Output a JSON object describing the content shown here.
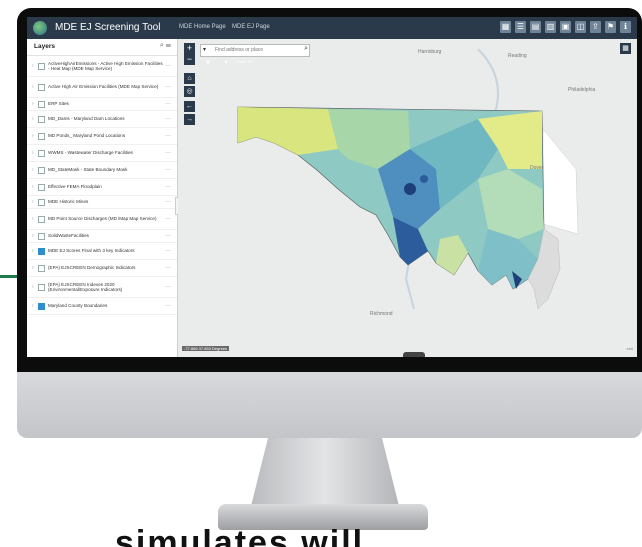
{
  "app": {
    "title": "MDE EJ Screening Tool",
    "links": [
      "MDE Home Page",
      "MDE EJ Page"
    ]
  },
  "toolbar": {
    "icons": [
      "layers-icon",
      "legend-icon",
      "basemap-icon",
      "table-icon",
      "print-icon",
      "measure-icon",
      "share-icon",
      "bookmark-icon",
      "info-icon"
    ]
  },
  "layers_panel": {
    "title": "Layers",
    "items": [
      {
        "label": "ActiveHighAirEmissions - Active High Emission Facilities - Heat Map (MDE Map Service)",
        "checked": false
      },
      {
        "label": "Active High Air Emission Facilities (MDE Map Service)",
        "checked": false
      },
      {
        "label": "ERP Sites",
        "checked": false
      },
      {
        "label": "MD_Dams - Maryland Dam Locations",
        "checked": false
      },
      {
        "label": "MD Ponds_ Maryland Pond Locations",
        "checked": false
      },
      {
        "label": "WWMS - Wastewater Discharge Facilities",
        "checked": false
      },
      {
        "label": "MD_StateMask - State Boundary Mask",
        "checked": false
      },
      {
        "label": "Effective FEMA Floodplain",
        "checked": false
      },
      {
        "label": "MDE Historic Mines",
        "checked": false
      },
      {
        "label": "MD Point Source Discharges (MD iMap Map Service)",
        "checked": false
      },
      {
        "label": "SolidWasteFacilities",
        "checked": false
      },
      {
        "label": "MDE EJ Scores Final with 3 key Indicators",
        "checked": true
      },
      {
        "label": "(EPA) EJSCREEN Demographic Indicators",
        "checked": false
      },
      {
        "label": "(EPA) EJSCREEN Indexes 2020 (Environmental/Exposure Indicators)",
        "checked": false
      },
      {
        "label": "Maryland County Boundaries",
        "checked": true
      }
    ]
  },
  "map": {
    "search_placeholder": "Find address or place",
    "widgets": [
      {
        "label": "",
        "color": "#8fb34d"
      },
      {
        "label": "",
        "color": "#a8943f"
      },
      {
        "label": "Zoom To",
        "color": "#6f8597"
      }
    ],
    "cities": [
      "Harrisburg",
      "Reading",
      "Philadelphia",
      "Dover",
      "Richmond"
    ],
    "scale": "-77.866 37.853 Degrees"
  },
  "page": {
    "caption": "simulates will"
  }
}
